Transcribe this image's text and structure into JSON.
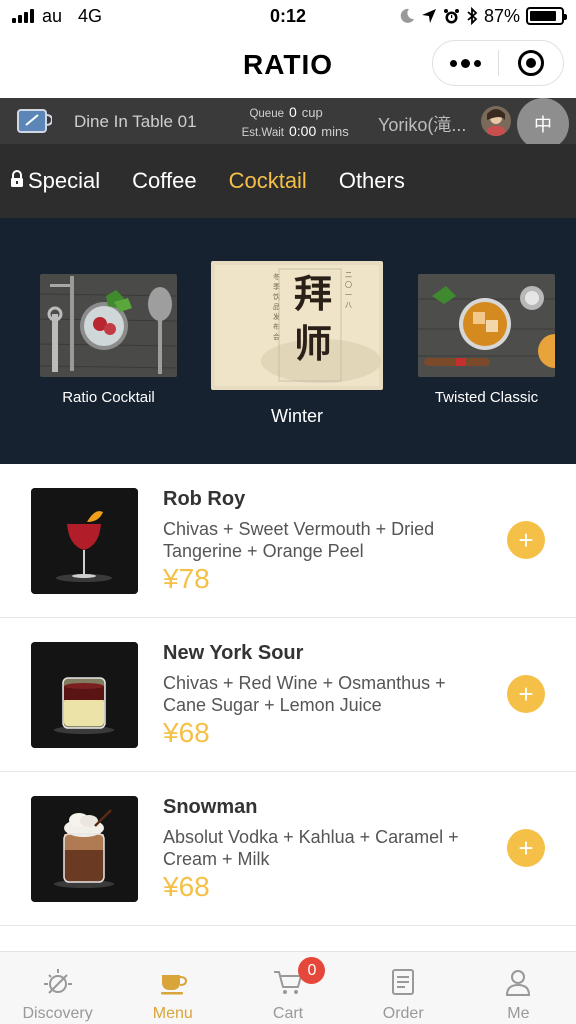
{
  "status_bar": {
    "carrier": "au",
    "network": "4G",
    "time": "0:12",
    "battery": "87%",
    "battery_level": 0.87
  },
  "title_bar": {
    "title": "RATIO"
  },
  "info_bar": {
    "table": "Dine In Table  01",
    "queue_label": "Queue",
    "queue_value": "0",
    "queue_unit": "cup",
    "wait_label": "Est.Wait",
    "wait_value": "0:00",
    "wait_unit": "mins",
    "user_name": "Yoriko(滝...",
    "language": "中"
  },
  "categories": [
    {
      "label": "Special",
      "active": false,
      "locked": true
    },
    {
      "label": "Coffee",
      "active": false,
      "locked": false
    },
    {
      "label": "Cocktail",
      "active": true,
      "locked": false
    },
    {
      "label": "Others",
      "active": false,
      "locked": false
    }
  ],
  "banner": {
    "cards": [
      {
        "label": "Ratio Cocktail"
      },
      {
        "label": "Winter",
        "art_text": "拜师"
      },
      {
        "label": "Twisted Classic"
      }
    ]
  },
  "products": [
    {
      "name": "Rob Roy",
      "desc": "Chivas + Sweet Vermouth + Dried Tangerine + Orange Peel",
      "price": "¥78",
      "add": "+"
    },
    {
      "name": "New York Sour",
      "desc": "Chivas + Red Wine + Osmanthus + Cane Sugar + Lemon Juice",
      "price": "¥68",
      "add": "+"
    },
    {
      "name": "Snowman",
      "desc": "Absolut Vodka + Kahlua + Caramel + Cream + Milk",
      "price": "¥68",
      "add": "+"
    }
  ],
  "bottom_nav": {
    "items": [
      {
        "label": "Discovery",
        "icon": "discovery-icon"
      },
      {
        "label": "Menu",
        "icon": "cup-icon"
      },
      {
        "label": "Cart",
        "icon": "cart-icon",
        "badge": "0"
      },
      {
        "label": "Order",
        "icon": "order-icon"
      },
      {
        "label": "Me",
        "icon": "person-icon"
      }
    ],
    "active_color": "#d9a53a",
    "badge_color": "#e5483a"
  },
  "colors": {
    "accent": "#f5c047",
    "dark_bar": "#2d2d2d",
    "banner_bg": "#172231"
  }
}
